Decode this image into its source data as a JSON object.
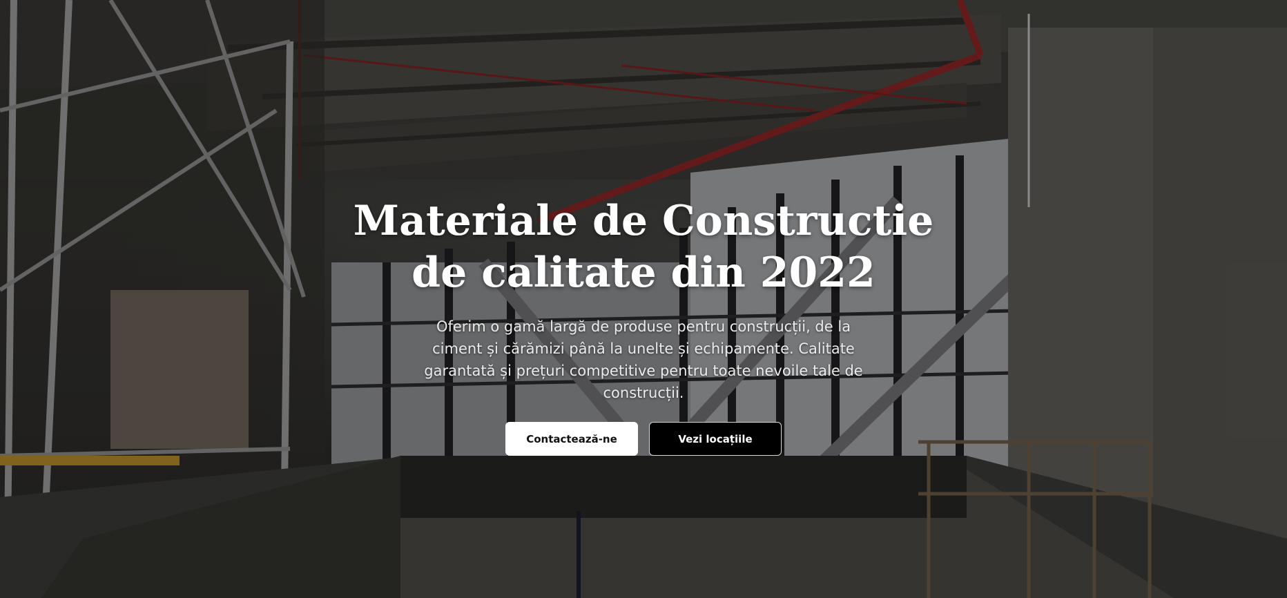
{
  "hero": {
    "title_line1": "Materiale de Constructie",
    "title_line2": "de calitate din 2022",
    "subtitle": "Oferim o gamă largă de produse pentru construcții, de la ciment și cărămizi până la unelte și echipamente. Calitate garantată și prețuri competitive pentru toate nevoile tale de construcții.",
    "primary_button": "Contactează-ne",
    "secondary_button": "Vezi locațiile"
  },
  "colors": {
    "overlay": "#000000",
    "text": "#ffffff",
    "primary_button_bg": "#ffffff",
    "secondary_button_bg": "#000000",
    "pipe_red": "#7a1f1f"
  },
  "background": {
    "description_icon": "construction-site-photo"
  }
}
